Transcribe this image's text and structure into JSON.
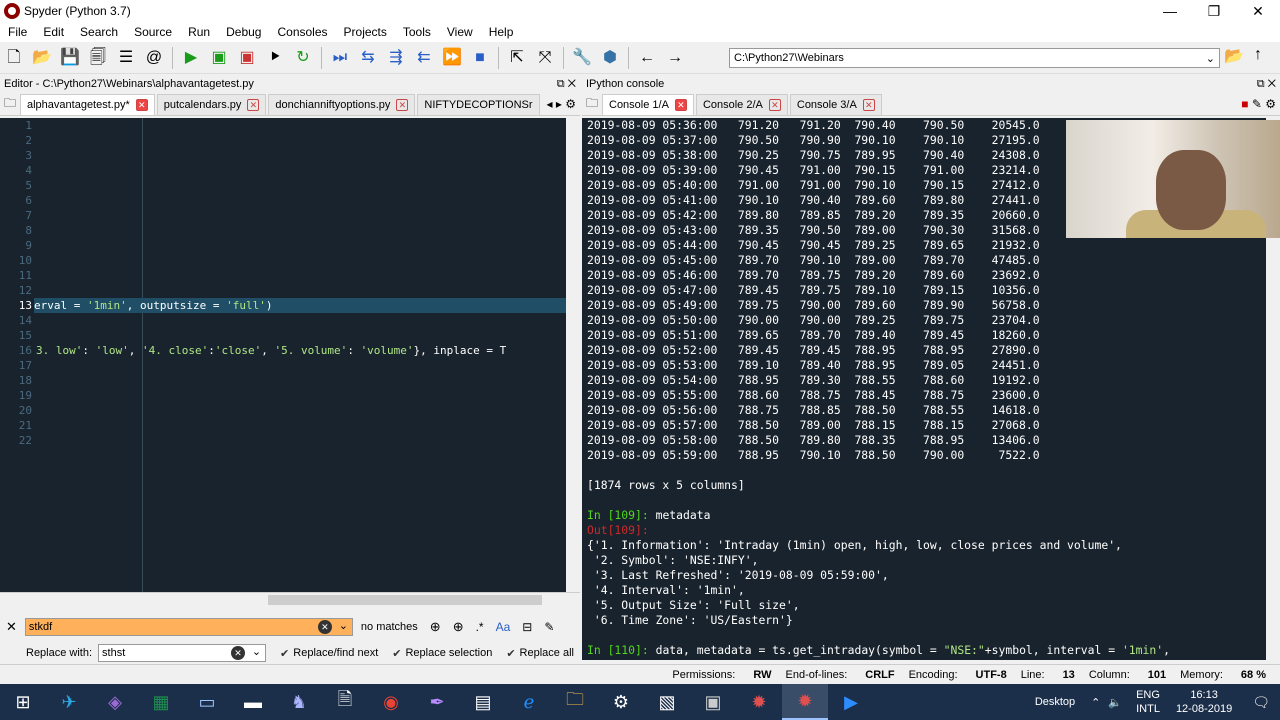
{
  "window": {
    "title": "Spyder (Python 3.7)",
    "min": "—",
    "max": "❐",
    "close": "✕"
  },
  "menu": [
    "File",
    "Edit",
    "Search",
    "Source",
    "Run",
    "Debug",
    "Consoles",
    "Projects",
    "Tools",
    "View",
    "Help"
  ],
  "toolbar": {
    "path": "C:\\Python27\\Webinars"
  },
  "editor": {
    "title": "Editor - C:\\Python27\\Webinars\\alphavantagetest.py",
    "tabs": [
      {
        "label": "alphavantagetest.py*",
        "active": true
      },
      {
        "label": "putcalendars.py",
        "active": false
      },
      {
        "label": "donchianniftyoptions.py",
        "active": false
      },
      {
        "label": "NIFTYDECOPTIONSr",
        "active": false
      }
    ],
    "line_numbers": [
      "1",
      "2",
      "3",
      "4",
      "5",
      "6",
      "7",
      "8",
      "9",
      "10",
      "11",
      "12",
      "13",
      "14",
      "15",
      "16",
      "17",
      "18",
      "19",
      "20",
      "21",
      "22"
    ],
    "line13_a": "erval = ",
    "line13_b": "'1min'",
    "line13_c": ", outputsize = ",
    "line13_d": "'full'",
    "line13_e": ")",
    "line16_a": "3. low'",
    "line16_b": ": ",
    "line16_c": "'low'",
    "line16_d": ", ",
    "line16_e": "'4. close'",
    "line16_f": ":",
    "line16_g": "'close'",
    "line16_h": ", ",
    "line16_i": "'5. volume'",
    "line16_j": ": ",
    "line16_k": "'volume'",
    "line16_l": "}, inplace = T"
  },
  "console": {
    "title": "IPython console",
    "tabs": [
      {
        "label": "Console 1/A",
        "active": true
      },
      {
        "label": "Console 2/A",
        "active": false
      },
      {
        "label": "Console 3/A",
        "active": false
      }
    ],
    "rows": [
      "2019-08-09 05:36:00   791.20   791.20  790.40    790.50    20545.0",
      "2019-08-09 05:37:00   790.50   790.90  790.10    790.10    27195.0",
      "2019-08-09 05:38:00   790.25   790.75  789.95    790.40    24308.0",
      "2019-08-09 05:39:00   790.45   791.00  790.15    791.00    23214.0",
      "2019-08-09 05:40:00   791.00   791.00  790.10    790.15    27412.0",
      "2019-08-09 05:41:00   790.10   790.40  789.60    789.80    27441.0",
      "2019-08-09 05:42:00   789.80   789.85  789.20    789.35    20660.0",
      "2019-08-09 05:43:00   789.35   790.50  789.00    790.30    31568.0",
      "2019-08-09 05:44:00   790.45   790.45  789.25    789.65    21932.0",
      "2019-08-09 05:45:00   789.70   790.10  789.00    789.70    47485.0",
      "2019-08-09 05:46:00   789.70   789.75  789.20    789.60    23692.0",
      "2019-08-09 05:47:00   789.45   789.75  789.10    789.15    10356.0",
      "2019-08-09 05:49:00   789.75   790.00  789.60    789.90    56758.0",
      "2019-08-09 05:50:00   790.00   790.00  789.25    789.75    23704.0",
      "2019-08-09 05:51:00   789.65   789.70  789.40    789.45    18260.0",
      "2019-08-09 05:52:00   789.45   789.45  788.95    788.95    27890.0",
      "2019-08-09 05:53:00   789.10   789.40  788.95    789.05    24451.0",
      "2019-08-09 05:54:00   788.95   789.30  788.55    788.60    19192.0",
      "2019-08-09 05:55:00   788.60   788.75  788.45    788.75    23600.0",
      "2019-08-09 05:56:00   788.75   788.85  788.50    788.55    14618.0",
      "2019-08-09 05:57:00   788.50   789.00  788.15    788.15    27068.0",
      "2019-08-09 05:58:00   788.50   789.80  788.35    788.95    13406.0",
      "2019-08-09 05:59:00   788.95   790.10  788.50    790.00     7522.0"
    ],
    "shape": "[1874 rows x 5 columns]",
    "in109": "In [109]:",
    "in109_cmd": " metadata",
    "out109": "Out[109]:",
    "meta": [
      "{'1. Information': 'Intraday (1min) open, high, low, close prices and volume',",
      " '2. Symbol': 'NSE:INFY',",
      " '3. Last Refreshed': '2019-08-09 05:59:00',",
      " '4. Interval': '1min',",
      " '5. Output Size': 'Full size',",
      " '6. Time Zone': 'US/Eastern'}"
    ],
    "in110": "In [110]:",
    "in110_a": " data, metadata = ts.get_intraday(symbol = ",
    "in110_b": "\"NSE:\"",
    "in110_c": "+symbol, interval = ",
    "in110_d": "'1min'",
    "in110_e": ","
  },
  "find": {
    "search_value": "stkdf",
    "no_matches": "no matches",
    "replace_label": "Replace with:",
    "replace_value": "sthst",
    "replace_find_next": "Replace/find next",
    "replace_selection": "Replace selection",
    "replace_all": "Replace all"
  },
  "status": {
    "permissions_label": "Permissions:",
    "permissions": "RW",
    "eol_label": "End-of-lines:",
    "eol": "CRLF",
    "encoding_label": "Encoding:",
    "encoding": "UTF-8",
    "line_label": "Line:",
    "line": "13",
    "column_label": "Column:",
    "column": "101",
    "memory_label": "Memory:",
    "memory": "68 %"
  },
  "tray": {
    "desktop": "Desktop",
    "lang1": "ENG",
    "lang2": "INTL",
    "time": "16:13",
    "date": "12-08-2019"
  }
}
